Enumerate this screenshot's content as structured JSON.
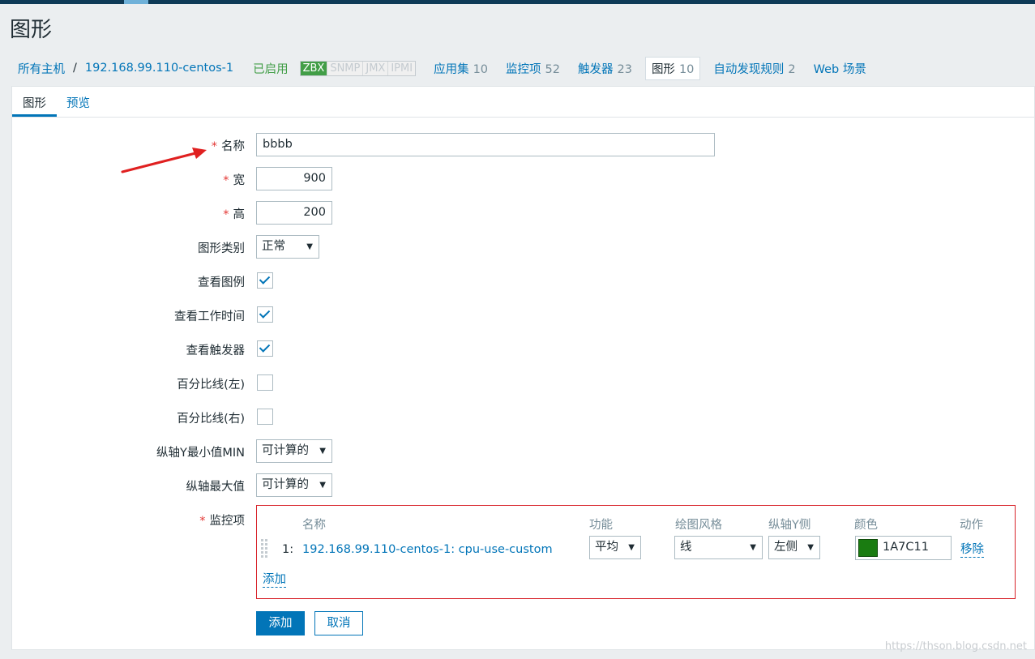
{
  "page": {
    "title": "图形",
    "watermark": "https://thson.blog.csdn.net"
  },
  "breadcrumb": {
    "all_hosts": "所有主机",
    "separator": "/",
    "host": "192.168.99.110-centos-1",
    "status": "已启用",
    "availability": [
      "ZBX",
      "SNMP",
      "JMX",
      "IPMI"
    ],
    "tabs": [
      {
        "label": "应用集",
        "count": "10"
      },
      {
        "label": "监控项",
        "count": "52"
      },
      {
        "label": "触发器",
        "count": "23"
      },
      {
        "label": "图形",
        "count": "10"
      },
      {
        "label": "自动发现规则",
        "count": "2"
      },
      {
        "label": "Web 场景",
        "count": ""
      }
    ]
  },
  "subtabs": [
    "图形",
    "预览"
  ],
  "form": {
    "name_label": "名称",
    "name_value": "bbbb",
    "width_label": "宽",
    "width_value": "900",
    "height_label": "高",
    "height_value": "200",
    "type_label": "图形类别",
    "type_value": "正常",
    "show_legend_label": "查看图例",
    "show_legend": true,
    "show_worktime_label": "查看工作时间",
    "show_worktime": true,
    "show_triggers_label": "查看触发器",
    "show_triggers": true,
    "percentile_left_label": "百分比线(左)",
    "percentile_left": false,
    "percentile_right_label": "百分比线(右)",
    "percentile_right": false,
    "ymin_label": "纵轴Y最小值MIN",
    "ymin_value": "可计算的",
    "ymax_label": "纵轴最大值",
    "ymax_value": "可计算的",
    "items_label": "监控项",
    "required_mark": "*"
  },
  "items_table": {
    "headers": {
      "name": "名称",
      "function": "功能",
      "style": "绘图风格",
      "axis": "纵轴Y侧",
      "color": "颜色",
      "action": "动作"
    },
    "rows": [
      {
        "num": "1:",
        "name": "192.168.99.110-centos-1: cpu-use-custom",
        "function": "平均",
        "style": "线",
        "axis": "左侧",
        "color": "1A7C11",
        "color_hex": "#1A7C11",
        "action": "移除"
      }
    ],
    "add_link": "添加"
  },
  "buttons": {
    "add": "添加",
    "cancel": "取消"
  },
  "colors": {
    "link": "#0275b8",
    "required": "#e33734",
    "enabled": "#429e47",
    "highlight_box": "#d8232a"
  }
}
